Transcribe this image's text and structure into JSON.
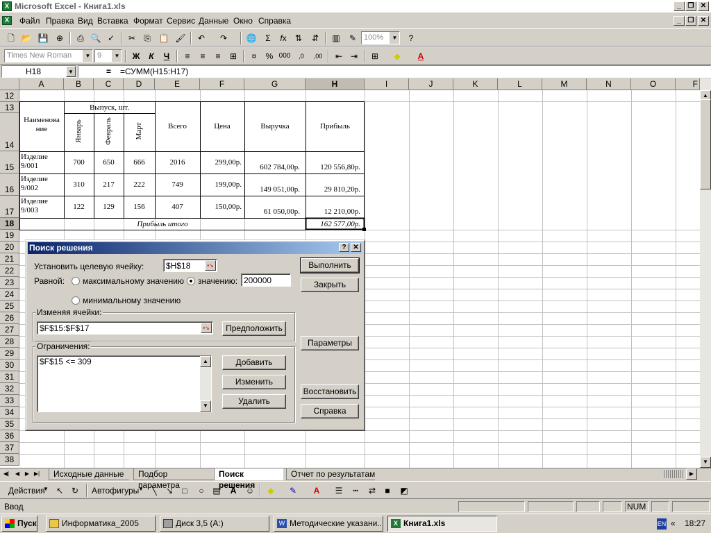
{
  "window": {
    "title": "Microsoft Excel - Книга1.xls"
  },
  "menu": [
    "Файл",
    "Правка",
    "Вид",
    "Вставка",
    "Формат",
    "Сервис",
    "Данные",
    "Окно",
    "Справка"
  ],
  "toolbar": {
    "zoom": "100%",
    "font_name": "Times New Roman",
    "font_size": "9",
    "bold": "Ж",
    "italic": "К",
    "underline": "Ч"
  },
  "formula_bar": {
    "name_box": "H18",
    "eq": "=",
    "formula": "=СУММ(H15:H17)"
  },
  "columns": [
    "A",
    "B",
    "C",
    "D",
    "E",
    "F",
    "G",
    "H",
    "I",
    "J",
    "K",
    "L",
    "M",
    "N",
    "O",
    "F"
  ],
  "rows": [
    "12",
    "13",
    "14",
    "15",
    "16",
    "17",
    "18",
    "19",
    "20",
    "21",
    "22",
    "23",
    "24",
    "25",
    "26",
    "27",
    "28",
    "29",
    "30",
    "31",
    "32",
    "33",
    "34",
    "35",
    "36",
    "37",
    "38"
  ],
  "sheet": {
    "header_name": "Наименова ние",
    "header_output": "Выпуск, шт.",
    "month_jan": "Январь",
    "month_feb": "Февраль",
    "month_mar": "Март",
    "header_total": "Всего",
    "header_price": "Цена",
    "header_revenue": "Выручка",
    "header_profit": "Прибыль",
    "items": [
      {
        "name": "Изделие 9/001",
        "jan": "700",
        "feb": "650",
        "mar": "666",
        "total": "2016",
        "price": "299,00р.",
        "revenue": "602 784,00р.",
        "profit": "120 556,80р."
      },
      {
        "name": "Изделие 9/002",
        "jan": "310",
        "feb": "217",
        "mar": "222",
        "total": "749",
        "price": "199,00р.",
        "revenue": "149 051,00р.",
        "profit": "29 810,20р."
      },
      {
        "name": "Изделие 9/003",
        "jan": "122",
        "feb": "129",
        "mar": "156",
        "total": "407",
        "price": "150,00р.",
        "revenue": "61 050,00р.",
        "profit": "12 210,00р."
      }
    ],
    "total_label": "Прибыль итого",
    "total_value": "162 577,00р."
  },
  "dialog": {
    "title": "Поиск решения",
    "help_btn": "?",
    "close_btn": "✕",
    "target_label": "Установить целевую ячейку:",
    "target_value": "$H$18",
    "equal_label": "Равной:",
    "opt_max": "максимальному значению",
    "opt_value": "значению:",
    "value": "200000",
    "opt_min": "минимальному значению",
    "changing_label": "Изменяя ячейки:",
    "changing_value": "$F$15:$F$17",
    "guess_btn": "Предположить",
    "constraints_label": "Ограничения:",
    "constraints": [
      "$F$15 <= 309"
    ],
    "add_btn": "Добавить",
    "change_btn": "Изменить",
    "delete_btn": "Удалить",
    "solve_btn": "Выполнить",
    "close_label": "Закрыть",
    "options_btn": "Параметры",
    "reset_btn": "Восстановить",
    "help_label": "Справка"
  },
  "tabs": [
    "Исходные данные",
    "Подбор параметра",
    "Поиск решения",
    "Отчет по результатам"
  ],
  "drawing": {
    "actions": "Действия",
    "autoshapes": "Автофигуры"
  },
  "status": {
    "mode": "Ввод",
    "num": "NUM"
  },
  "taskbar": {
    "start": "Пуск",
    "items": [
      "Информатика_2005",
      "Диск 3,5 (A:)",
      "Методические указани...",
      "Книга1.xls"
    ],
    "lang": "EN",
    "time": "18:27"
  },
  "colors": {
    "title_gradient_start": "#0a246a",
    "title_gradient_end": "#a6caf0",
    "excel_green": "#1f7a3a"
  }
}
